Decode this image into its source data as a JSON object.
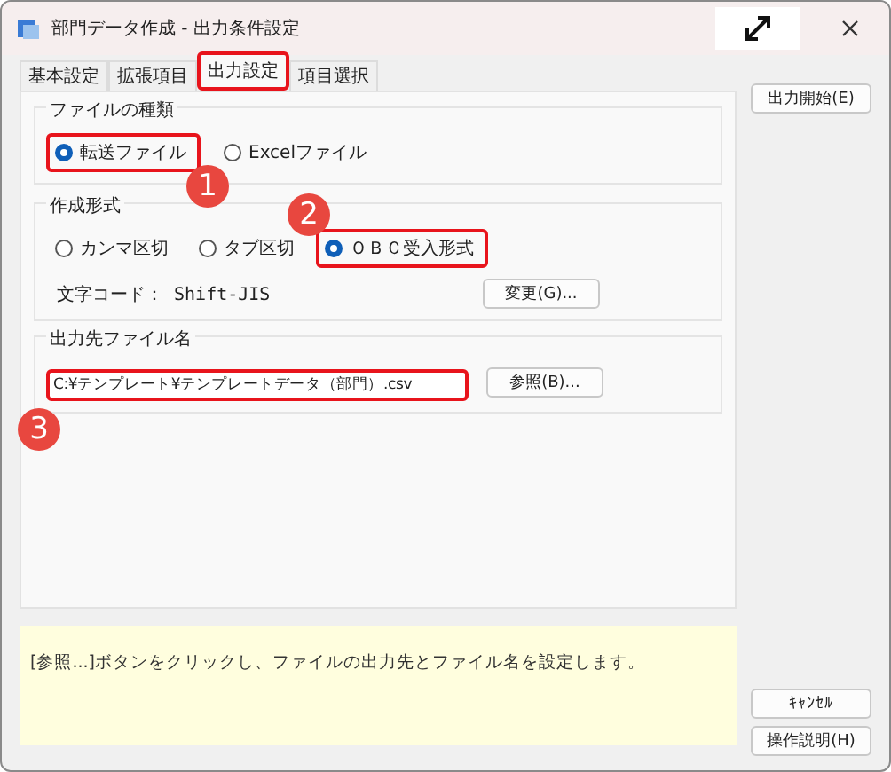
{
  "window": {
    "title": "部門データ作成 - 出力条件設定"
  },
  "tabs": [
    {
      "label": "基本設定",
      "selected": false,
      "highlighted": false
    },
    {
      "label": "拡張項目",
      "selected": false,
      "highlighted": false
    },
    {
      "label": "出力設定",
      "selected": true,
      "highlighted": true
    },
    {
      "label": "項目選択",
      "selected": false,
      "highlighted": false
    }
  ],
  "file_type": {
    "title": "ファイルの種類",
    "options": [
      {
        "label": "転送ファイル",
        "selected": true,
        "highlighted": true,
        "callout": "1"
      },
      {
        "label": "Excelファイル",
        "selected": false,
        "highlighted": false
      }
    ]
  },
  "format": {
    "title": "作成形式",
    "options": [
      {
        "label": "カンマ区切",
        "selected": false,
        "highlighted": false
      },
      {
        "label": "タブ区切",
        "selected": false,
        "highlighted": false
      },
      {
        "label": "ＯＢＣ受入形式",
        "selected": true,
        "highlighted": true,
        "callout": "2"
      }
    ],
    "encoding": "文字コード： Shift-JIS",
    "button": "変更(G)..."
  },
  "output_file": {
    "title": "出力先ファイル名",
    "value": "C:¥テンプレート¥テンプレートデータ（部門）.csv",
    "highlighted": true,
    "callout": "3",
    "button": "参照(B)..."
  },
  "help_text": "[参照...]ボタンをクリックし、ファイルの出力先とファイル名を設定します。",
  "side_buttons": {
    "top": [
      "出力開始(E)"
    ],
    "bottom": [
      "ｷｬﾝｾﾙ",
      "操作説明(H)"
    ]
  }
}
